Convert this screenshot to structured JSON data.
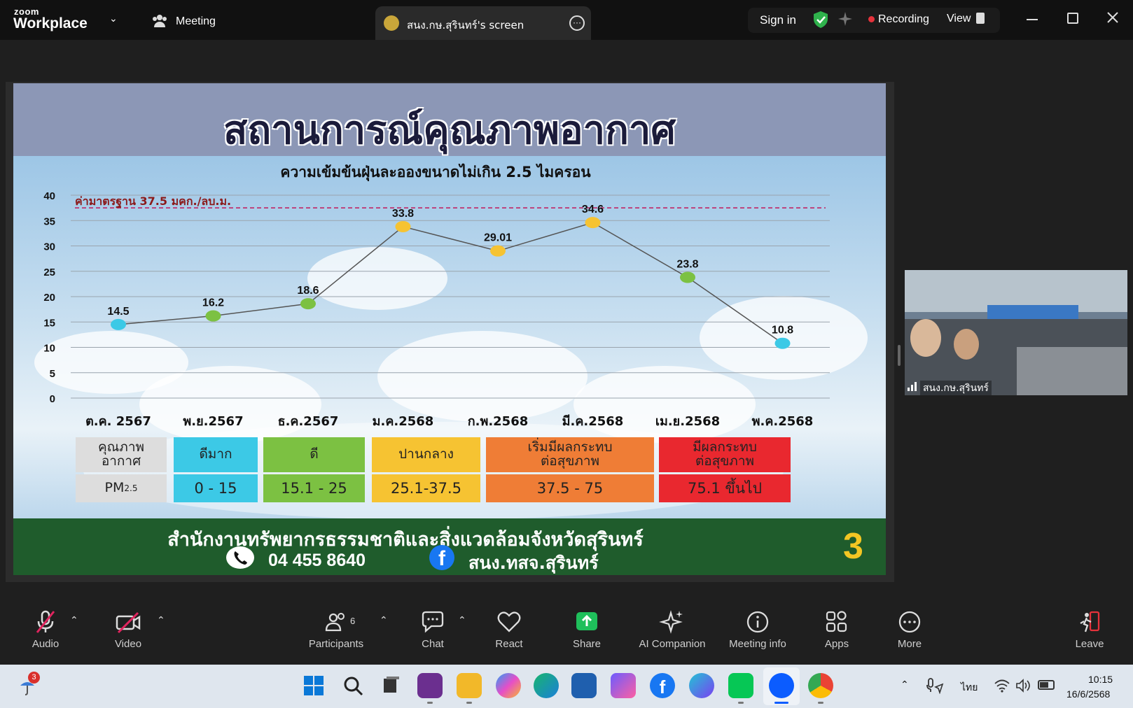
{
  "app": {
    "brand_small": "zoom",
    "brand_big": "Workplace",
    "meeting_label": "Meeting",
    "share_tab_title": "สนง.กษ.สุรินทร์'s screen",
    "sign_in": "Sign in",
    "recording": "Recording",
    "view": "View"
  },
  "slide": {
    "title": "สถานการณ์คุณภาพอากาศ",
    "standard_label": "ค่ามาตรฐาน 37.5 มคก./ลบ.ม.",
    "footer_org": "สำนักงานทรัพยากรธรรมชาติและสิ่งแวดล้อมจังหวัดสุรินทร์",
    "phone": "04 455 8640",
    "facebook": "สนง.ทสจ.สุรินทร์",
    "page_number": "3",
    "legend": {
      "row1_header": "คุณภาพ\nอากาศ",
      "row2_header": "PM",
      "row2_sub": "2.5",
      "levels": [
        {
          "name": "ดีมาก",
          "range": "0 - 15",
          "color": "#3cc9e6"
        },
        {
          "name": "ดี",
          "range": "15.1 - 25",
          "color": "#7cc142"
        },
        {
          "name": "ปานกลาง",
          "range": "25.1-37.5",
          "color": "#f6c332"
        },
        {
          "name": "เริ่มมีผลกระทบ\nต่อสุขภาพ",
          "range": "37.5 - 75",
          "color": "#ef7d36"
        },
        {
          "name": "มีผลกระทบ\nต่อสุขภาพ",
          "range": "75.1 ขึ้นไป",
          "color": "#e9282f"
        }
      ]
    }
  },
  "chart_data": {
    "type": "line",
    "title": "ความเข้มข้นฝุ่นละอองขนาดไม่เกิน 2.5 ไมครอน",
    "categories": [
      "ต.ค. 2567",
      "พ.ย.2567",
      "ธ.ค.2567",
      "ม.ค.2568",
      "ก.พ.2568",
      "มี.ค.2568",
      "เม.ย.2568",
      "พ.ค.2568"
    ],
    "values": [
      14.5,
      16.2,
      18.6,
      33.8,
      29.01,
      34.6,
      23.8,
      10.8
    ],
    "value_labels": [
      "14.5",
      "16.2",
      "18.6",
      "33.8",
      "29.01",
      "34.6",
      "23.8",
      "10.8"
    ],
    "point_colors": [
      "#3cc9e6",
      "#7cc142",
      "#7cc142",
      "#f6c332",
      "#f6c332",
      "#f6c332",
      "#7cc142",
      "#3cc9e6"
    ],
    "ylim": [
      0,
      40
    ],
    "yticks": [
      0,
      5,
      10,
      15,
      20,
      25,
      30,
      35,
      40
    ],
    "standard_line": 37.5,
    "grid": true
  },
  "participant": {
    "name": "สนง.กษ.สุรินทร์"
  },
  "toolbar": {
    "audio": "Audio",
    "video": "Video",
    "participants": "Participants",
    "participants_count": "6",
    "chat": "Chat",
    "react": "React",
    "share": "Share",
    "ai_companion": "AI Companion",
    "meeting_info": "Meeting info",
    "apps": "Apps",
    "more": "More",
    "leave": "Leave"
  },
  "taskbar": {
    "weather_badge": "3",
    "lang": "ไทย",
    "time": "10:15",
    "date": "16/6/2568"
  }
}
